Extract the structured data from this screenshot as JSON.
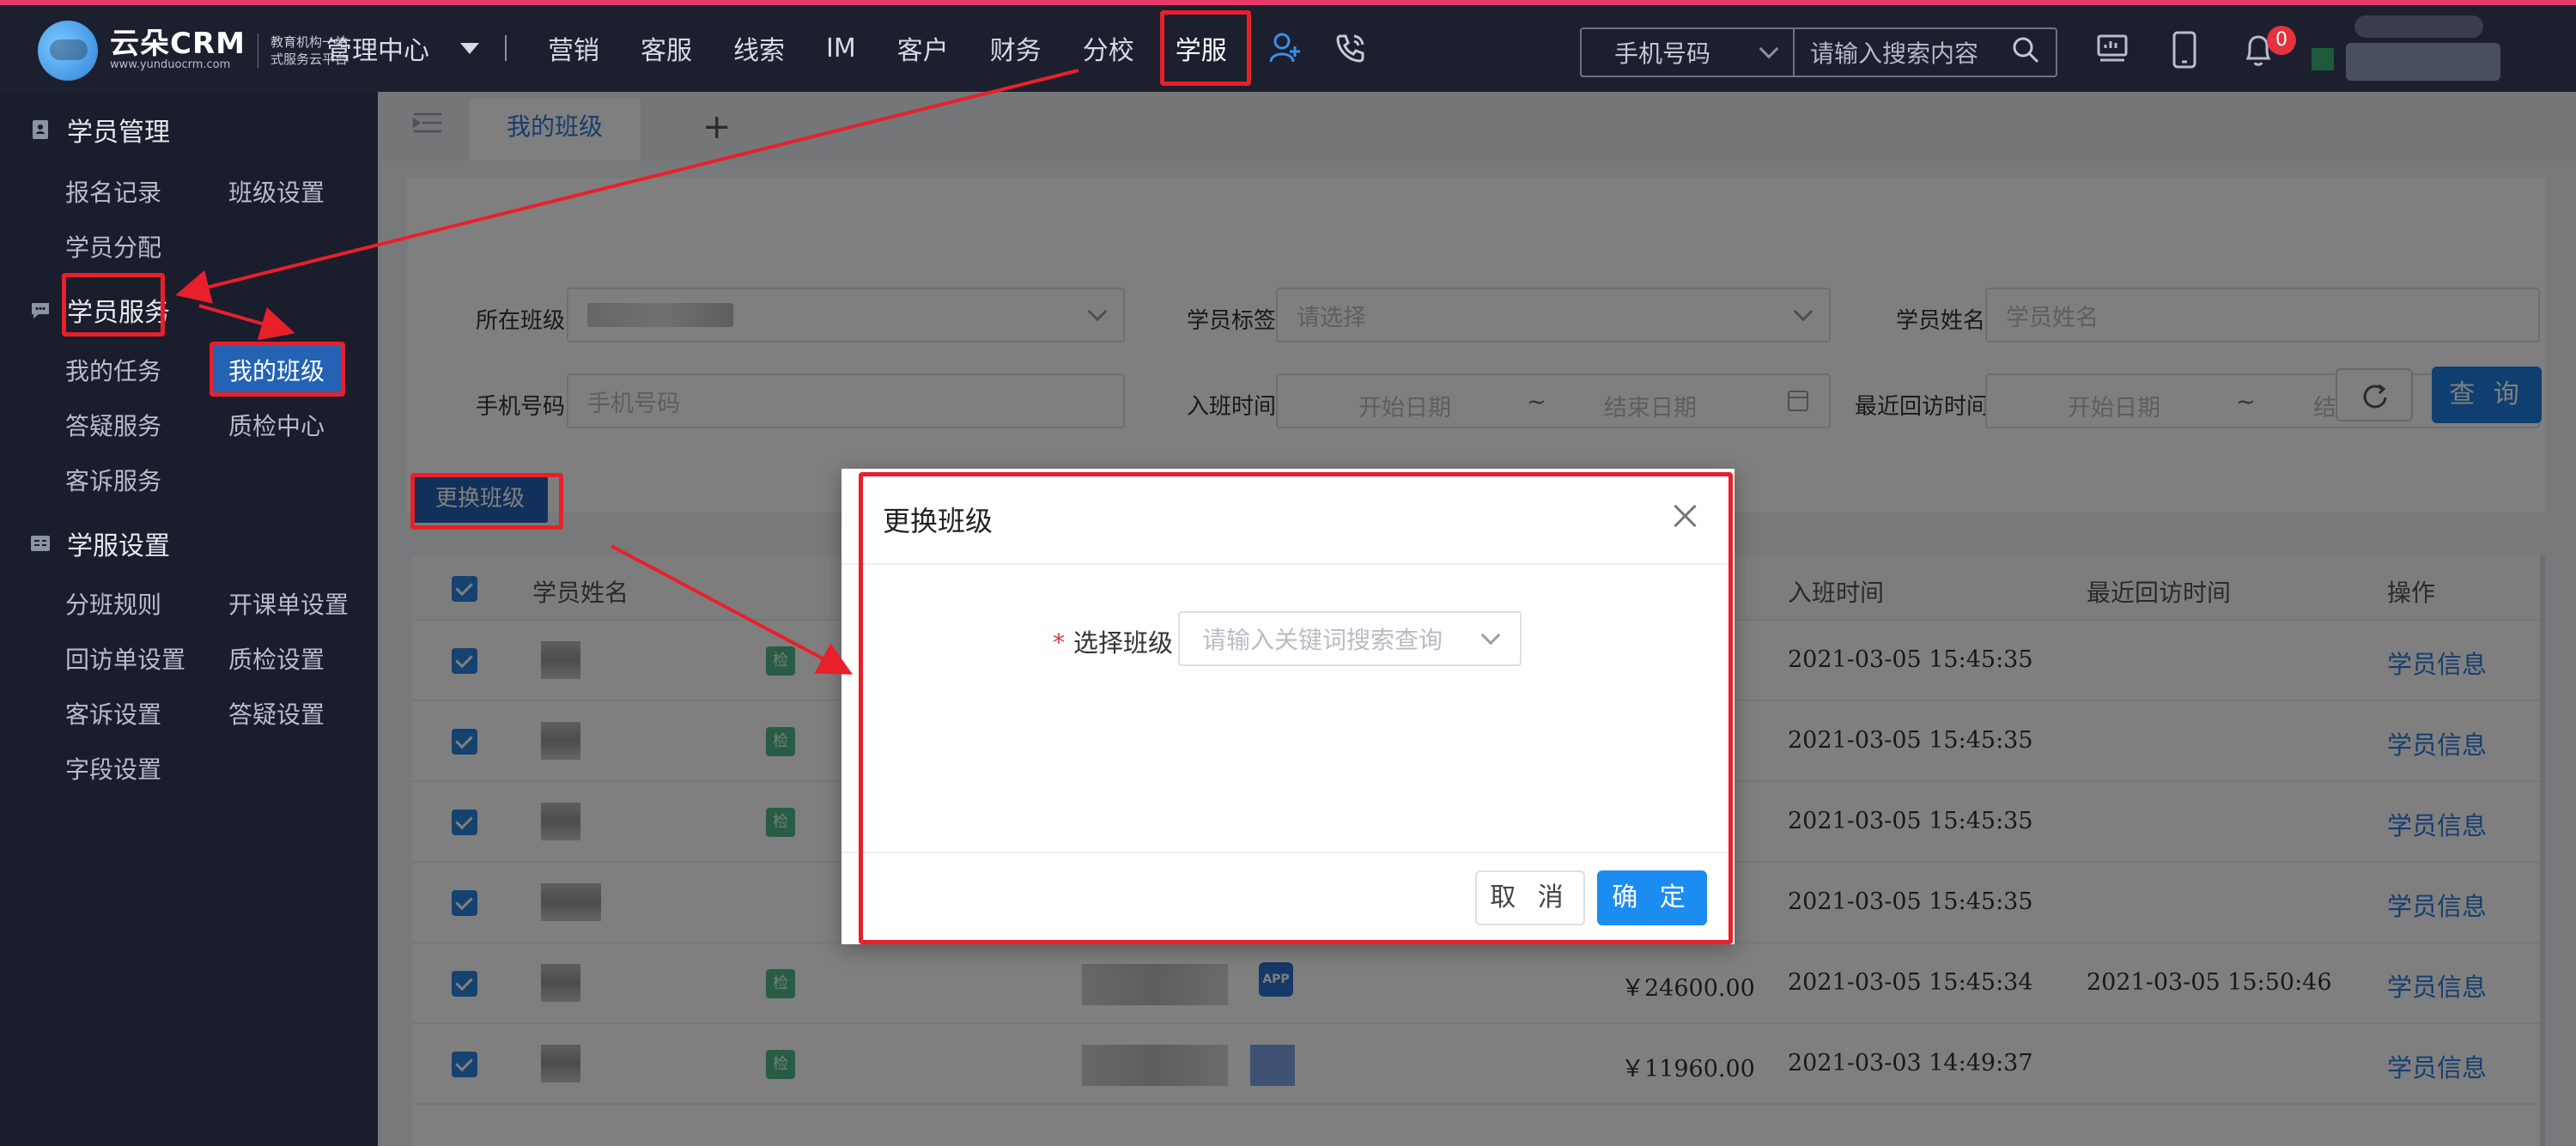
{
  "logo": {
    "brand": "云朵CRM",
    "domain": "www.yunduocrm.com",
    "slogan_line1": "教育机构一站",
    "slogan_line2": "式服务云平台"
  },
  "nav": {
    "management": "管理中心",
    "items": [
      "营销",
      "客服",
      "线索",
      "IM",
      "客户",
      "财务",
      "分校",
      "学服"
    ],
    "active": "学服"
  },
  "search": {
    "type_value": "手机号码",
    "placeholder": "请输入搜索内容"
  },
  "notifications": {
    "count": "0"
  },
  "sidebar": {
    "group1": {
      "title": "学员管理",
      "items": [
        "报名记录",
        "班级设置",
        "学员分配"
      ]
    },
    "group2": {
      "title": "学员服务",
      "items": [
        "我的任务",
        "我的班级",
        "答疑服务",
        "质检中心",
        "客诉服务"
      ]
    },
    "group3": {
      "title": "学服设置",
      "items": [
        "分班规则",
        "开课单设置",
        "回访单设置",
        "质检设置",
        "客诉设置",
        "答疑设置",
        "字段设置"
      ]
    }
  },
  "tabs": {
    "current": "我的班级",
    "add": "+"
  },
  "filters": {
    "class_label": "所在班级",
    "tag_label": "学员标签",
    "tag_placeholder": "请选择",
    "name_label": "学员姓名",
    "name_placeholder": "学员姓名",
    "phone_label": "手机号码",
    "phone_placeholder": "手机号码",
    "join_label": "入班时间",
    "visit_label": "最近回访时间",
    "start_placeholder": "开始日期",
    "end_placeholder": "结束日期",
    "range_sep": "~",
    "query_button": "查 询"
  },
  "change_class_button": "更换班级",
  "table": {
    "headers": {
      "name": "学员姓名",
      "join_time": "入班时间",
      "last_visit": "最近回访时间",
      "action": "操作"
    },
    "tag_label": "检",
    "app_label": "APP",
    "action_link": "学员信息",
    "rows": [
      {
        "amount": "",
        "join_time": "2021-03-05 15:45:35",
        "last_visit": ""
      },
      {
        "amount": "",
        "join_time": "2021-03-05 15:45:35",
        "last_visit": ""
      },
      {
        "amount": "",
        "join_time": "2021-03-05 15:45:35",
        "last_visit": ""
      },
      {
        "amount": "",
        "join_time": "2021-03-05 15:45:35",
        "last_visit": ""
      },
      {
        "amount": "￥24600.00",
        "join_time": "2021-03-05 15:45:34",
        "last_visit": "2021-03-05 15:50:46"
      },
      {
        "amount": "￥11960.00",
        "join_time": "2021-03-03 14:49:37",
        "last_visit": ""
      }
    ]
  },
  "dialog": {
    "title": "更换班级",
    "required_mark": "*",
    "field_label": "选择班级",
    "select_placeholder": "请输入关键词搜索查询",
    "cancel": "取 消",
    "confirm": "确 定"
  },
  "colors": {
    "accent": "#1c7fe0",
    "annotation": "#e8202b",
    "nav_bg": "#1c1f2e"
  }
}
